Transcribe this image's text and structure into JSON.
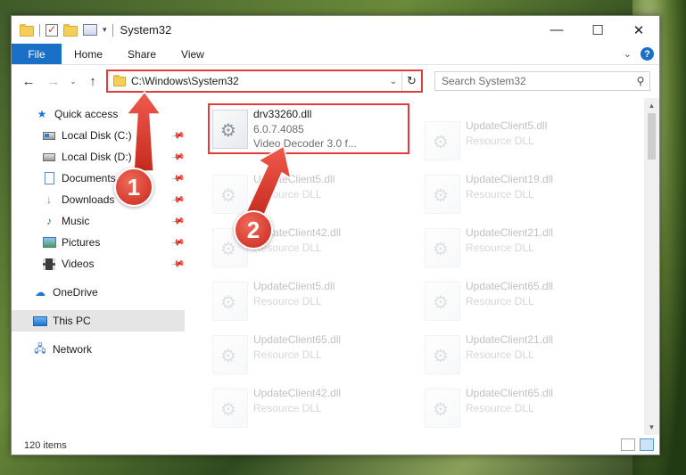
{
  "window": {
    "title": "System32",
    "minimize_glyph": "—",
    "maximize_glyph": "☐",
    "close_glyph": "✕"
  },
  "ribbon": {
    "tabs": [
      "File",
      "Home",
      "Share",
      "View"
    ],
    "expand_glyph": "⌄",
    "help_glyph": "?"
  },
  "navbar": {
    "back_glyph": "←",
    "forward_glyph": "→",
    "recent_glyph": "⌄",
    "up_glyph": "↑",
    "address": "C:\\Windows\\System32",
    "address_dropdown_glyph": "⌄",
    "refresh_glyph": "↻",
    "search_placeholder": "Search System32",
    "search_icon": "search-icon"
  },
  "sidebar": {
    "items": [
      {
        "label": "Quick access",
        "icon": "star-icon",
        "pinned": false
      },
      {
        "label": "Local Disk (C:)",
        "icon": "drive-c-icon",
        "pinned": true
      },
      {
        "label": "Local Disk (D:)",
        "icon": "drive-d-icon",
        "pinned": true
      },
      {
        "label": "Documents",
        "icon": "documents-icon",
        "pinned": true
      },
      {
        "label": "Downloads",
        "icon": "downloads-icon",
        "pinned": true
      },
      {
        "label": "Music",
        "icon": "music-icon",
        "pinned": true
      },
      {
        "label": "Pictures",
        "icon": "pictures-icon",
        "pinned": true
      },
      {
        "label": "Videos",
        "icon": "videos-icon",
        "pinned": true
      },
      {
        "label": "OneDrive",
        "icon": "onedrive-icon",
        "pinned": false
      },
      {
        "label": "This PC",
        "icon": "this-pc-icon",
        "pinned": false,
        "selected": true
      },
      {
        "label": "Network",
        "icon": "network-icon",
        "pinned": false
      }
    ]
  },
  "files": {
    "highlighted": {
      "name": "drv33260.dll",
      "version": "6.0.7.4085",
      "description": "Video Decoder 3.0 f..."
    },
    "left_column": [
      {
        "name": "UpdateClient5.dll",
        "description": "Resource DLL"
      },
      {
        "name": "UpdateClient42.dll",
        "description": "Resource DLL"
      },
      {
        "name": "UpdateClient5.dll",
        "description": "Resource DLL"
      },
      {
        "name": "UpdateClient65.dll",
        "description": "Resource DLL"
      },
      {
        "name": "UpdateClient42.dll",
        "description": "Resource DLL"
      }
    ],
    "right_column": [
      {
        "name": "UpdateClient5.dll",
        "description": "Resource DLL"
      },
      {
        "name": "UpdateClient19.dll",
        "description": "Resource DLL"
      },
      {
        "name": "UpdateClient21.dll",
        "description": "Resource DLL"
      },
      {
        "name": "UpdateClient65.dll",
        "description": "Resource DLL"
      },
      {
        "name": "UpdateClient21.dll",
        "description": "Resource DLL"
      },
      {
        "name": "UpdateClient65.dll",
        "description": "Resource DLL"
      }
    ]
  },
  "statusbar": {
    "item_count": "120 items"
  },
  "annotations": {
    "step1": "1",
    "step2": "2",
    "highlight_color": "#e23c3c"
  },
  "colors": {
    "accent": "#1a6fc7",
    "callout": "#d9362a"
  }
}
